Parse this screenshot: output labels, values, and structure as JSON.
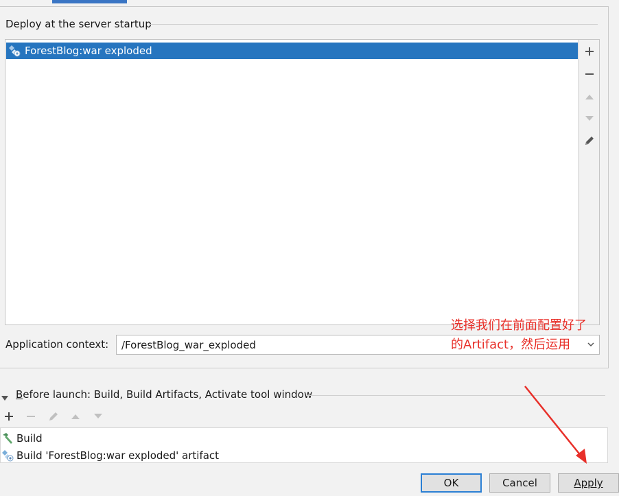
{
  "deploy_section": {
    "title": "Deploy at the server startup",
    "artifacts": [
      {
        "label": "ForestBlog:war exploded",
        "icon": "artifact-icon",
        "selected": true
      }
    ],
    "toolbar": {
      "add_icon": "plus-icon",
      "remove_icon": "minus-icon",
      "move_up_icon": "triangle-up-icon",
      "move_down_icon": "triangle-down-icon",
      "edit_icon": "pencil-icon"
    }
  },
  "app_context": {
    "label": "Application context:",
    "value": "/ForestBlog_war_exploded"
  },
  "annotation": {
    "line1": "选择我们在前面配置好了",
    "line2": "的Artifact，然后运用",
    "color": "#e8302a"
  },
  "before_launch": {
    "title": "Before launch: Build, Build Artifacts, Activate tool window",
    "mnemonic": "B",
    "title_rest": "efore launch: Build, Build Artifacts, Activate tool window",
    "tasks": [
      {
        "label": "Build",
        "icon": "hammer-icon"
      },
      {
        "label": "Build 'ForestBlog:war exploded' artifact",
        "icon": "artifact-icon"
      }
    ]
  },
  "buttons": {
    "ok": "OK",
    "cancel": "Cancel",
    "apply": "Apply"
  },
  "colors": {
    "selection": "#2675bf",
    "accent": "#3a75c4",
    "annotation": "#e8302a"
  }
}
